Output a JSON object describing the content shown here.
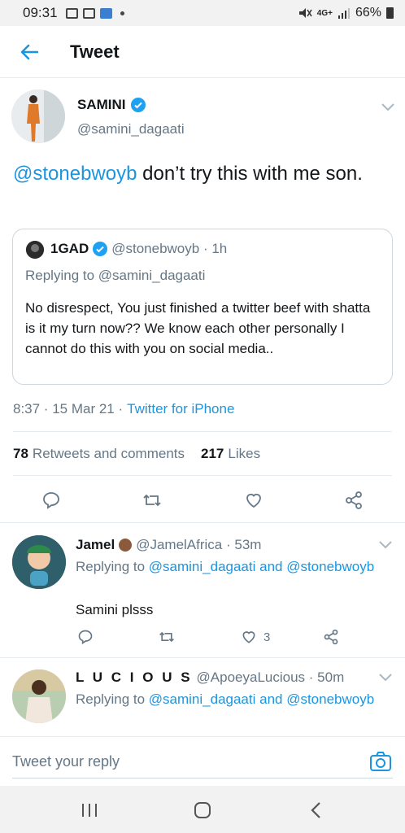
{
  "status_bar": {
    "time": "09:31",
    "network": "4G+",
    "battery": "66%"
  },
  "header": {
    "title": "Tweet"
  },
  "tweet": {
    "display_name": "SAMINI",
    "handle": "@samini_dagaati",
    "mention": "@stonebwoyb",
    "text": " don’t try this with me son.",
    "timestamp": "8:37 · 15 Mar 21 ·",
    "source": "Twitter for iPhone",
    "retweet_count": "78",
    "retweet_label": "Retweets and comments",
    "like_count": "217",
    "like_label": "Likes"
  },
  "quoted": {
    "display_name": "1GAD",
    "handle": "@stonebwoyb · 1h",
    "replying_to": "Replying to @samini_dagaati",
    "text": "No disrespect, You  just finished a twitter beef with shatta is it my turn now?? We know each other personally I cannot do this with you on social media.."
  },
  "replies": [
    {
      "display_name": "Jamel",
      "handle": "@JamelAfrica · 53m",
      "replying_prefix": "Replying to ",
      "replying_mentions": "@samini_dagaati and @stonebwoyb",
      "text": "Samini plsss",
      "like_count": "3"
    },
    {
      "display_name": "L U C I O U S",
      "handle": "@ApoeyaLucious · 50m",
      "replying_prefix": "Replying to ",
      "replying_mentions": "@samini_dagaati and @stonebwoyb"
    }
  ],
  "reply_bar": {
    "placeholder": "Tweet your reply"
  },
  "colors": {
    "accent": "#1b95e0",
    "secondary_text": "#657786",
    "border": "#e6ecf0"
  },
  "icons": [
    "back-arrow-icon",
    "verified-icon",
    "chevron-down-icon",
    "reply-icon",
    "retweet-icon",
    "like-icon",
    "share-icon",
    "camera-icon",
    "recents-icon",
    "home-icon",
    "back-icon"
  ]
}
